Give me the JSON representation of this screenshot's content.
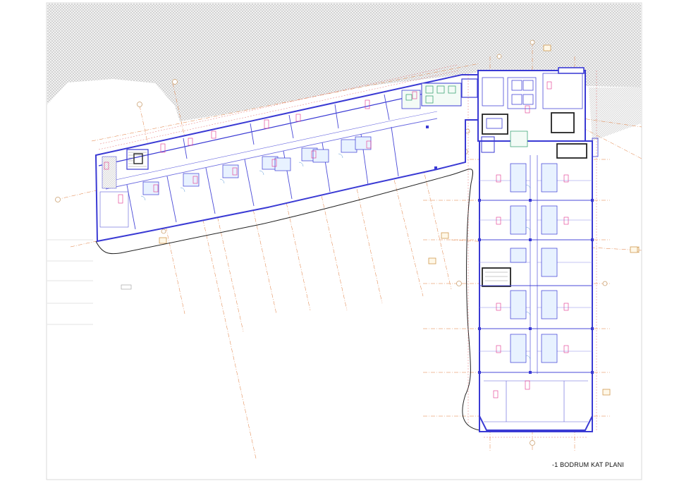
{
  "drawing": {
    "title": "-1 BODRUM KAT PLANI",
    "colors": {
      "wall": "#3a3ad4",
      "grid_axis": "#e07a3a",
      "dimension": "#e05050",
      "room_tag": "#e0308a",
      "fixture": "#2a9a6a",
      "site_outline": "#222222",
      "hatch": "#9a9a9a"
    }
  }
}
